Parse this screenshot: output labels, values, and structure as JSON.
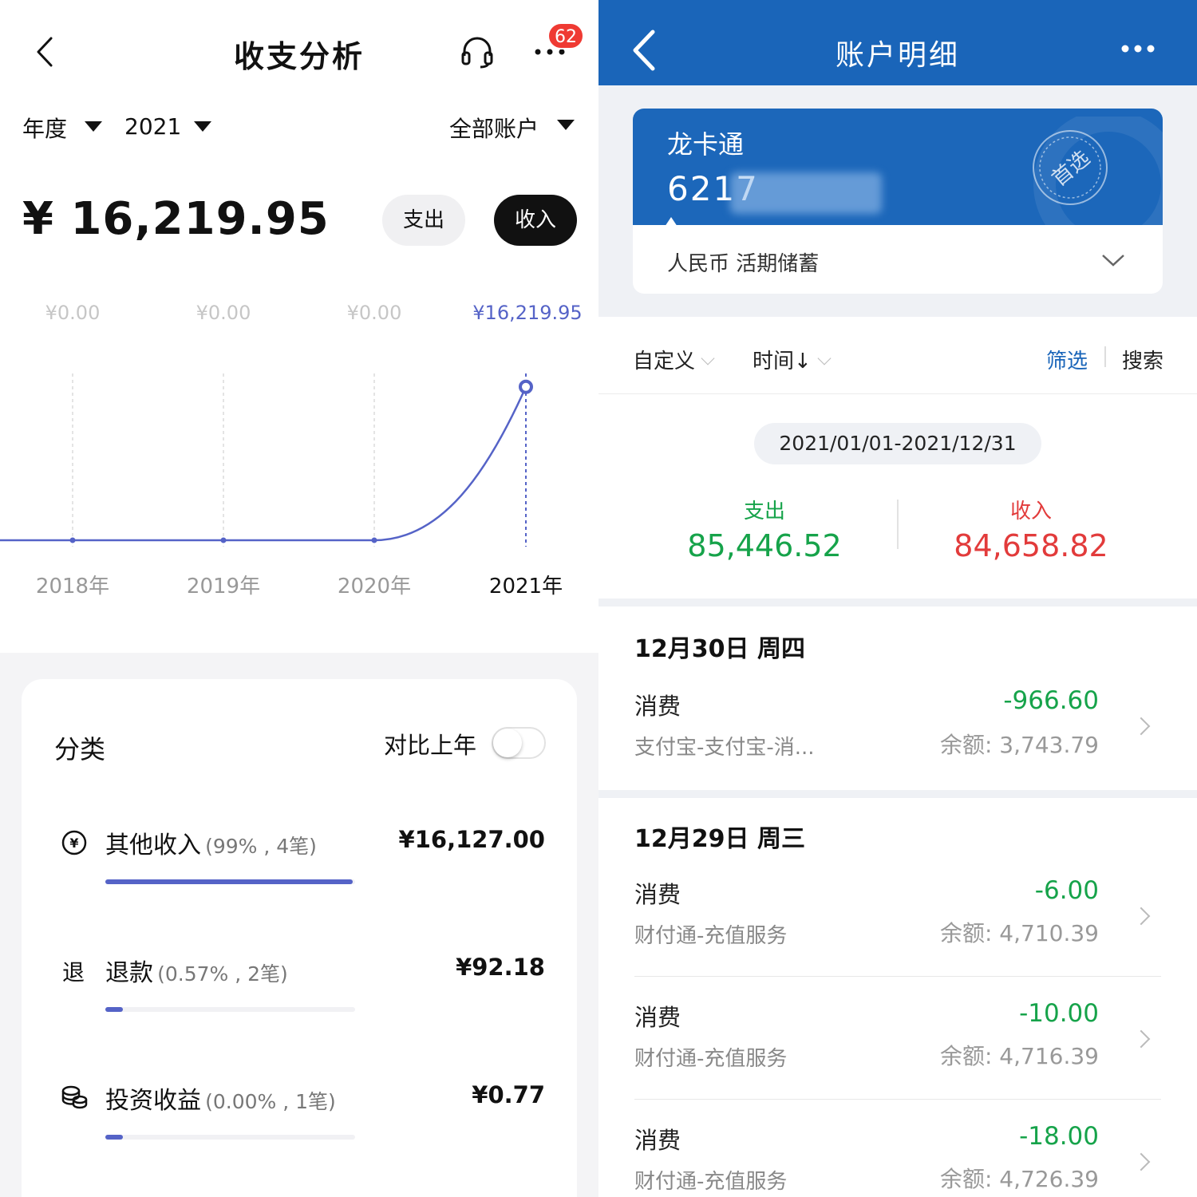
{
  "left": {
    "title": "收支分析",
    "badge": "62",
    "period_selector": "年度",
    "year_selector": "2021",
    "account_selector": "全部账户",
    "total_amount": "¥ 16,219.95",
    "btn_expense": "支出",
    "btn_income": "收入",
    "chart_data": {
      "type": "line",
      "categories": [
        "2018年",
        "2019年",
        "2020年",
        "2021年"
      ],
      "values": [
        0,
        0,
        0,
        16219.95
      ],
      "value_labels": [
        "¥0.00",
        "¥0.00",
        "¥0.00",
        "¥16,219.95"
      ],
      "highlighted_index": 3,
      "ylim": [
        0,
        20000
      ],
      "line_color": "#5563c7"
    },
    "category_section": {
      "title": "分类",
      "compare_label": "对比上年",
      "compare_on": false,
      "items": [
        {
          "icon": "yuan-circle-icon",
          "name": "其他收入",
          "meta": "(99% , 4笔)",
          "amount": "¥16,127.00",
          "share": 0.99
        },
        {
          "icon_text": "退",
          "name": "退款",
          "meta": "(0.57% , 2笔)",
          "amount": "¥92.18",
          "share": 0.0057
        },
        {
          "icon": "coins-icon",
          "name": "投资收益",
          "meta": "(0.00% , 1笔)",
          "amount": "¥0.77",
          "share": 0.0
        }
      ]
    }
  },
  "right": {
    "title": "账户明细",
    "card": {
      "name": "龙卡通",
      "number_visible": "6217",
      "type": "人民币 活期储蓄",
      "stamp": "首选"
    },
    "filters": {
      "custom": "自定义",
      "time": "时间↓",
      "filter": "筛选",
      "search": "搜索"
    },
    "date_range": "2021/01/01-2021/12/31",
    "summary": {
      "expense_label": "支出",
      "expense_value": "85,446.52",
      "income_label": "收入",
      "income_value": "84,658.82"
    },
    "colors": {
      "brand": "#1a65b9",
      "expense": "#16a34a",
      "income": "#e23b3b",
      "link": "#1a65b9"
    },
    "days": [
      {
        "title": "12月30日 周四",
        "transactions": [
          {
            "title": "消费",
            "desc": "支付宝-支付宝-消...",
            "amount": "-966.60",
            "balance": "余额: 3,743.79"
          }
        ]
      },
      {
        "title": "12月29日 周三",
        "transactions": [
          {
            "title": "消费",
            "desc": "财付通-充值服务",
            "amount": "-6.00",
            "balance": "余额: 4,710.39"
          },
          {
            "title": "消费",
            "desc": "财付通-充值服务",
            "amount": "-10.00",
            "balance": "余额: 4,716.39"
          },
          {
            "title": "消费",
            "desc": "财付通-充值服务",
            "amount": "-18.00",
            "balance": "余额: 4,726.39"
          }
        ]
      }
    ]
  }
}
